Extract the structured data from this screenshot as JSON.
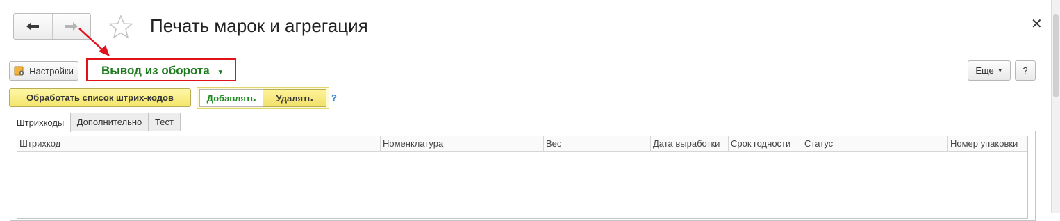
{
  "window": {
    "title": "Печать марок и агрегация",
    "close_glyph": "✕"
  },
  "toolbar": {
    "settings_label": "Настройки",
    "operation_label": "Вывод из оборота",
    "more_label": "Еще",
    "help_label": "?"
  },
  "actions": {
    "process_barcodes_label": "Обработать список штрих-кодов",
    "mode_add_label": "Добавлять",
    "mode_remove_label": "Удалять",
    "mode_selected": "Удалять",
    "mode_help": "?"
  },
  "tabs": [
    {
      "label": "Штрихкоды",
      "active": true
    },
    {
      "label": "Дополнительно",
      "active": false
    },
    {
      "label": "Тест",
      "active": false
    }
  ],
  "table": {
    "columns": [
      "Штрихкод",
      "Номенклатура",
      "Вес",
      "Дата выработки",
      "Срок годности",
      "Статус",
      "Номер упаковки"
    ],
    "rows": []
  },
  "icons": {
    "back": "arrow-left-icon",
    "forward": "arrow-right-icon",
    "favorite": "star-icon",
    "settings": "settings-gear-icon",
    "dropdown": "triangle-down-icon"
  },
  "colors": {
    "highlight_border": "#e0121a",
    "operation_text": "#1d7a1d",
    "annotation_arrow": "#e0121a",
    "yellow_button": "#f3e56b"
  }
}
